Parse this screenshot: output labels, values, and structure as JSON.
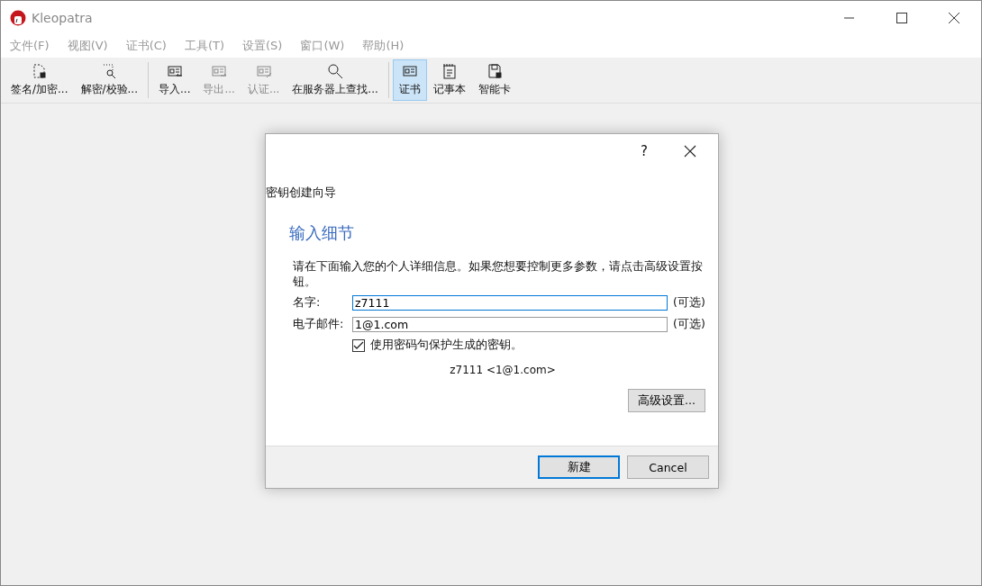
{
  "window": {
    "title": "Kleopatra"
  },
  "menu": [
    "文件(F)",
    "视图(V)",
    "证书(C)",
    "工具(T)",
    "设置(S)",
    "窗口(W)",
    "帮助(H)"
  ],
  "toolbar": [
    [
      {
        "label": "签名/加密...",
        "kind": "sign",
        "disabled": false,
        "selected": false
      },
      {
        "label": "解密/校验...",
        "kind": "decrypt",
        "disabled": false,
        "selected": false
      }
    ],
    [
      {
        "label": "导入...",
        "kind": "import",
        "disabled": false,
        "selected": false
      },
      {
        "label": "导出...",
        "kind": "export",
        "disabled": true,
        "selected": false
      },
      {
        "label": "认证...",
        "kind": "certify",
        "disabled": true,
        "selected": false
      },
      {
        "label": "在服务器上查找...",
        "kind": "search",
        "disabled": false,
        "selected": false
      }
    ],
    [
      {
        "label": "证书",
        "kind": "certificates",
        "disabled": false,
        "selected": true
      },
      {
        "label": "记事本",
        "kind": "notepad",
        "disabled": false,
        "selected": false
      },
      {
        "label": "智能卡",
        "kind": "smartcard",
        "disabled": false,
        "selected": false
      }
    ]
  ],
  "dialog": {
    "help": "?",
    "title": "密钥创建向导",
    "heading": "输入细节",
    "description": "请在下面输入您的个人详细信息。如果您想要控制更多参数，请点击高级设置按钮。",
    "fields": [
      {
        "label": "名字:",
        "value": "z7111",
        "note": "(可选)",
        "focused": true
      },
      {
        "label": "电子邮件:",
        "value": "1@1.com",
        "note": "(可选)",
        "focused": false
      }
    ],
    "passphrase": {
      "label": "使用密码句保护生成的密钥。",
      "checked": true
    },
    "preview": "z7111 <1@1.com>",
    "advanced_button": "高级设置...",
    "buttons": [
      {
        "label": "新建",
        "default": true
      },
      {
        "label": "Cancel",
        "default": false
      }
    ]
  }
}
